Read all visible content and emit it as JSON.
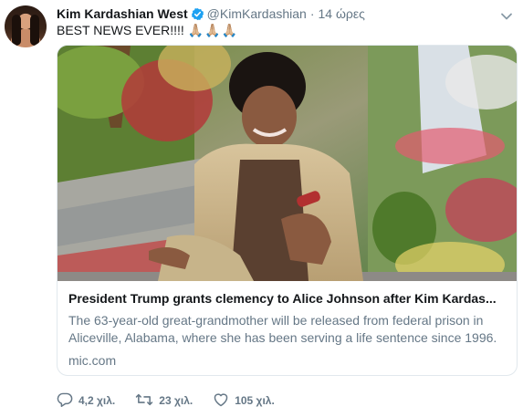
{
  "author": {
    "name": "Kim Kardashian West",
    "handle": "@KimKardashian",
    "time": "14 ώρες",
    "verified": true
  },
  "tweet": {
    "text": "BEST NEWS EVER!!!! ",
    "emoji": "🙏🏼🙏🏼🙏🏼"
  },
  "card": {
    "title": "President Trump grants clemency to Alice Johnson after Kim Kardas...",
    "description": "The 63-year-old great-grandmother will be released from federal prison in Aliceville, Alabama, where she has been serving a life sentence since 1996.",
    "domain": "mic.com"
  },
  "actions": {
    "replies": "4,2 χιλ.",
    "retweets": "23 χιλ.",
    "likes": "105 χιλ."
  },
  "colors": {
    "text_primary": "#14171a",
    "text_secondary": "#657786",
    "verified_blue": "#1da1f2",
    "border": "#e1e8ed"
  },
  "icons": [
    "verified-badge-icon",
    "chevron-down-icon",
    "reply-icon",
    "retweet-icon",
    "like-icon"
  ]
}
